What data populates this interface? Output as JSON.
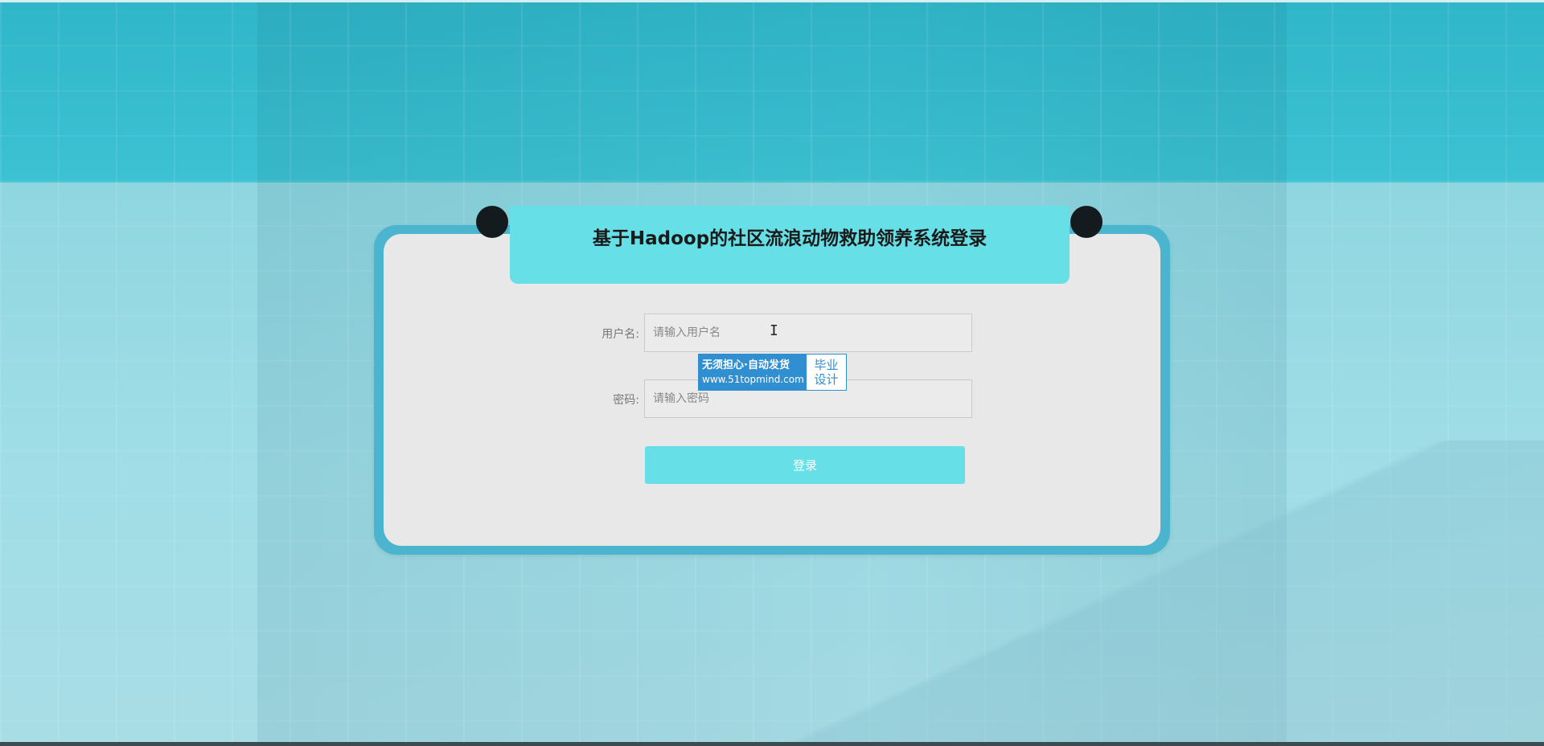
{
  "title": "基于Hadoop的社区流浪动物救助领养系统登录",
  "form": {
    "username_label": "用户名:",
    "username_placeholder": "请输入用户名",
    "username_value": "",
    "password_label": "密码:",
    "password_placeholder": "请输入密码",
    "password_value": "",
    "login_button": "登录"
  },
  "watermark": {
    "line1": "无须担心·自动发货",
    "line2": "www.51topmind.com",
    "side_top": "毕业",
    "side_bottom": "设计"
  },
  "colors": {
    "accent": "#66e0e6",
    "card_border": "#4bb5d0",
    "card_bg": "#e8e8e8",
    "badge": "#2f8fd0"
  },
  "icons": {
    "cursor": "text-cursor-icon"
  }
}
